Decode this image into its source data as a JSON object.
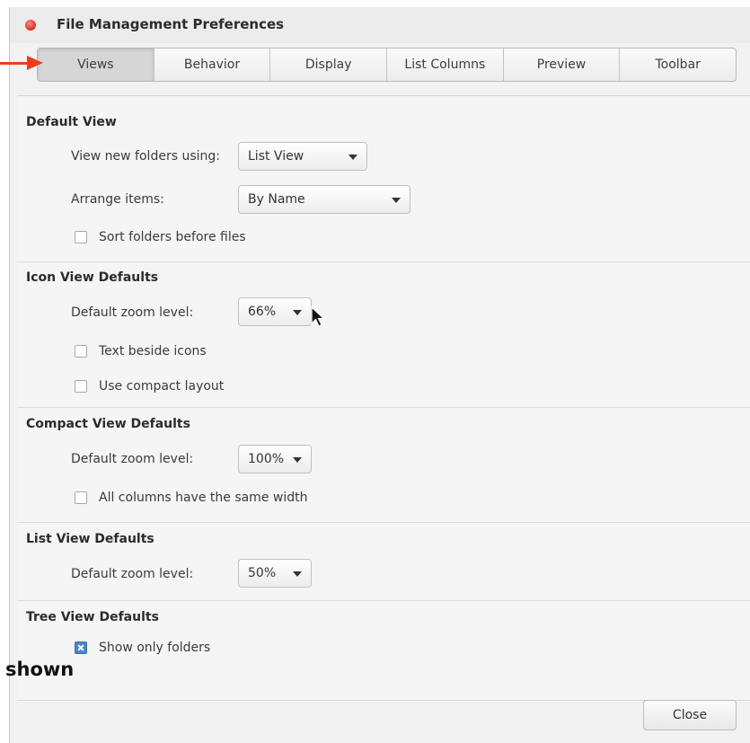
{
  "window": {
    "title": "File Management Preferences"
  },
  "tabs": [
    {
      "label": "Views",
      "active": true
    },
    {
      "label": "Behavior"
    },
    {
      "label": "Display"
    },
    {
      "label": "List Columns"
    },
    {
      "label": "Preview"
    },
    {
      "label": "Toolbar"
    }
  ],
  "default_view": {
    "title": "Default View",
    "view_new_label": "View new folders using:",
    "view_new_value": "List View",
    "arrange_label": "Arrange items:",
    "arrange_value": "By Name",
    "sort_folders_label": "Sort folders before files",
    "sort_folders_checked": false
  },
  "icon_view": {
    "title": "Icon View Defaults",
    "zoom_label": "Default zoom level:",
    "zoom_value": "66%",
    "text_beside_label": "Text beside icons",
    "text_beside_checked": false,
    "compact_layout_label": "Use compact layout",
    "compact_layout_checked": false
  },
  "compact_view": {
    "title": "Compact View Defaults",
    "zoom_label": "Default zoom level:",
    "zoom_value": "100%",
    "same_width_label": "All columns have the same width",
    "same_width_checked": false
  },
  "list_view": {
    "title": "List View Defaults",
    "zoom_label": "Default zoom level:",
    "zoom_value": "50%"
  },
  "tree_view": {
    "title": "Tree View Defaults",
    "only_folders_label": "Show only folders",
    "only_folders_checked": true
  },
  "footer": {
    "close_label": "Close"
  },
  "annotation": {
    "text": "shown",
    "arrow_color": "#e8401c"
  },
  "colors": {
    "accent": "#4a87c4",
    "close_dot": "#e0392b"
  }
}
